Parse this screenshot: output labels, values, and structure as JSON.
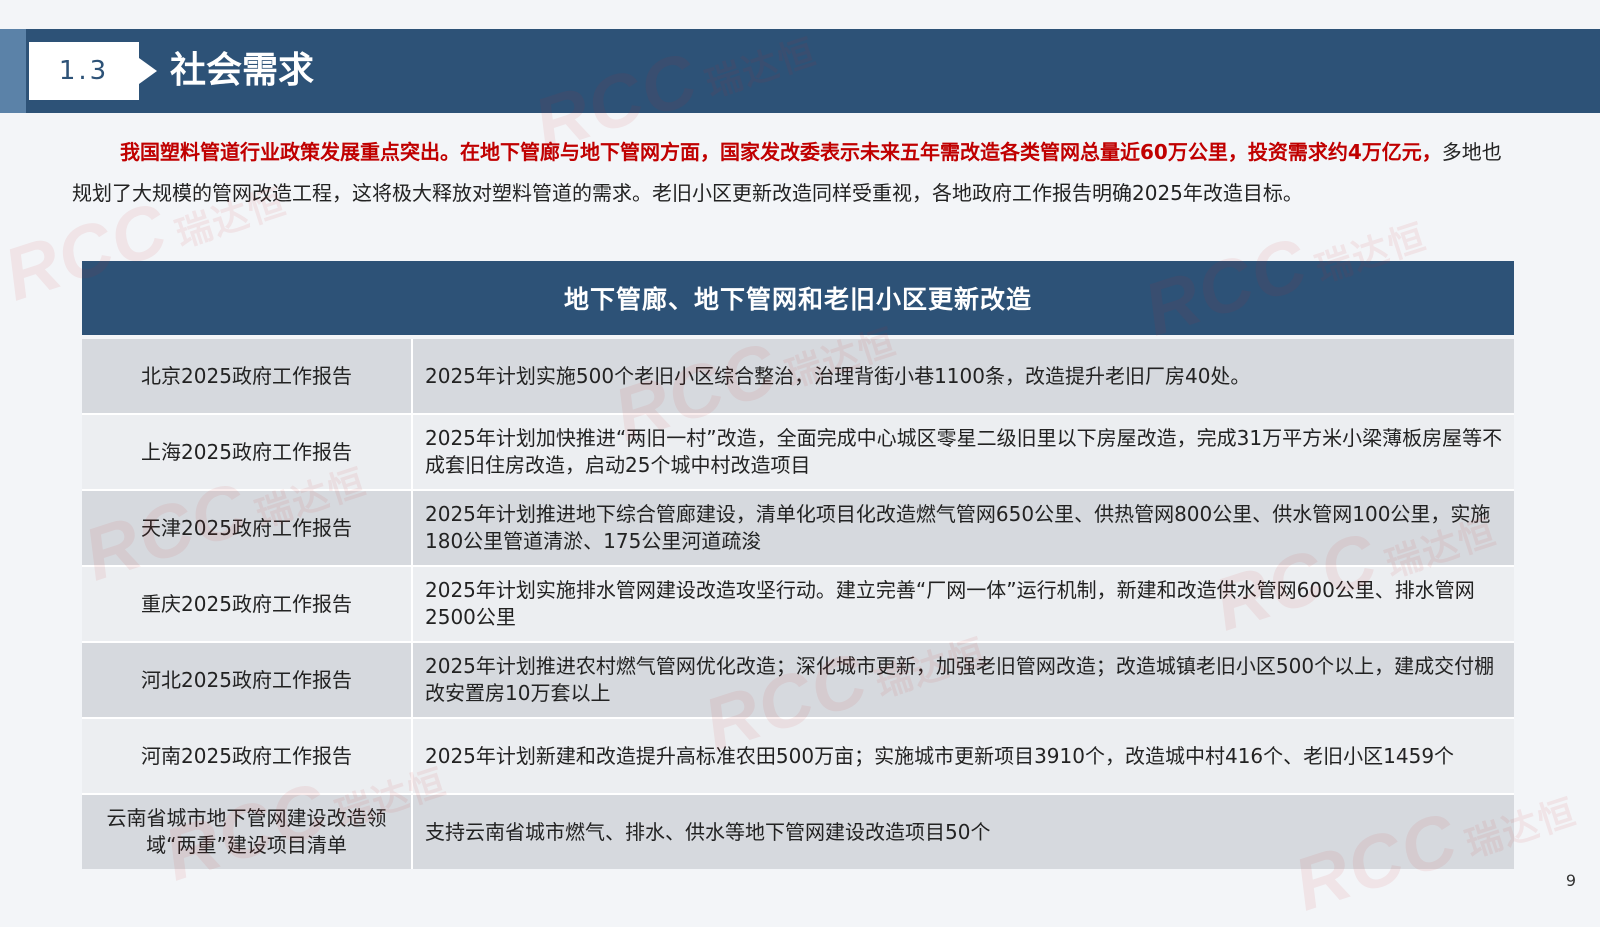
{
  "header": {
    "section_number": "1.3",
    "title": "社会需求"
  },
  "intro": {
    "highlight": "我国塑料管道行业政策发展重点突出。在地下管廊与地下管网方面，国家发改委表示未来五年需改造各类管网总量近60万公里，投资需求约4万亿元，",
    "body": "多地也规划了大规模的管网改造工程，这将极大释放对塑料管道的需求。老旧小区更新改造同样受重视，各地政府工作报告明确2025年改造目标。"
  },
  "table": {
    "title": "地下管廊、地下管网和老旧小区更新改造",
    "rows": [
      {
        "source": "北京2025政府工作报告",
        "content": "2025年计划实施500个老旧小区综合整治，治理背街小巷1100条，改造提升老旧厂房40处。"
      },
      {
        "source": "上海2025政府工作报告",
        "content": "2025年计划加快推进“两旧一村”改造，全面完成中心城区零星二级旧里以下房屋改造，完成31万平方米小梁薄板房屋等不成套旧住房改造，启动25个城中村改造项目"
      },
      {
        "source": "天津2025政府工作报告",
        "content": "2025年计划推进地下综合管廊建设，清单化项目化改造燃气管网650公里、供热管网800公里、供水管网100公里，实施180公里管道清淤、175公里河道疏浚"
      },
      {
        "source": "重庆2025政府工作报告",
        "content": "2025年计划实施排水管网建设改造攻坚行动。建立完善“厂网一体”运行机制，新建和改造供水管网600公里、排水管网2500公里"
      },
      {
        "source": "河北2025政府工作报告",
        "content": "2025年计划推进农村燃气管网优化改造；深化城市更新，加强老旧管网改造；改造城镇老旧小区500个以上，建成交付棚改安置房10万套以上"
      },
      {
        "source": "河南2025政府工作报告",
        "content": "2025年计划新建和改造提升高标准农田500万亩；实施城市更新项目3910个，改造城中村416个、老旧小区1459个"
      },
      {
        "source": "云南省城市地下管网建设改造领域“两重”建设项目清单",
        "content": "支持云南省城市燃气、排水、供水等地下管网建设改造项目50个"
      }
    ]
  },
  "page_number": "9",
  "watermark": {
    "latin": "RCC",
    "chinese": "瑞达恒"
  },
  "colors": {
    "header_blue": "#2d5277",
    "highlight_red": "#c00000",
    "row_dark": "#d6d9de",
    "row_light": "#eceef1"
  }
}
